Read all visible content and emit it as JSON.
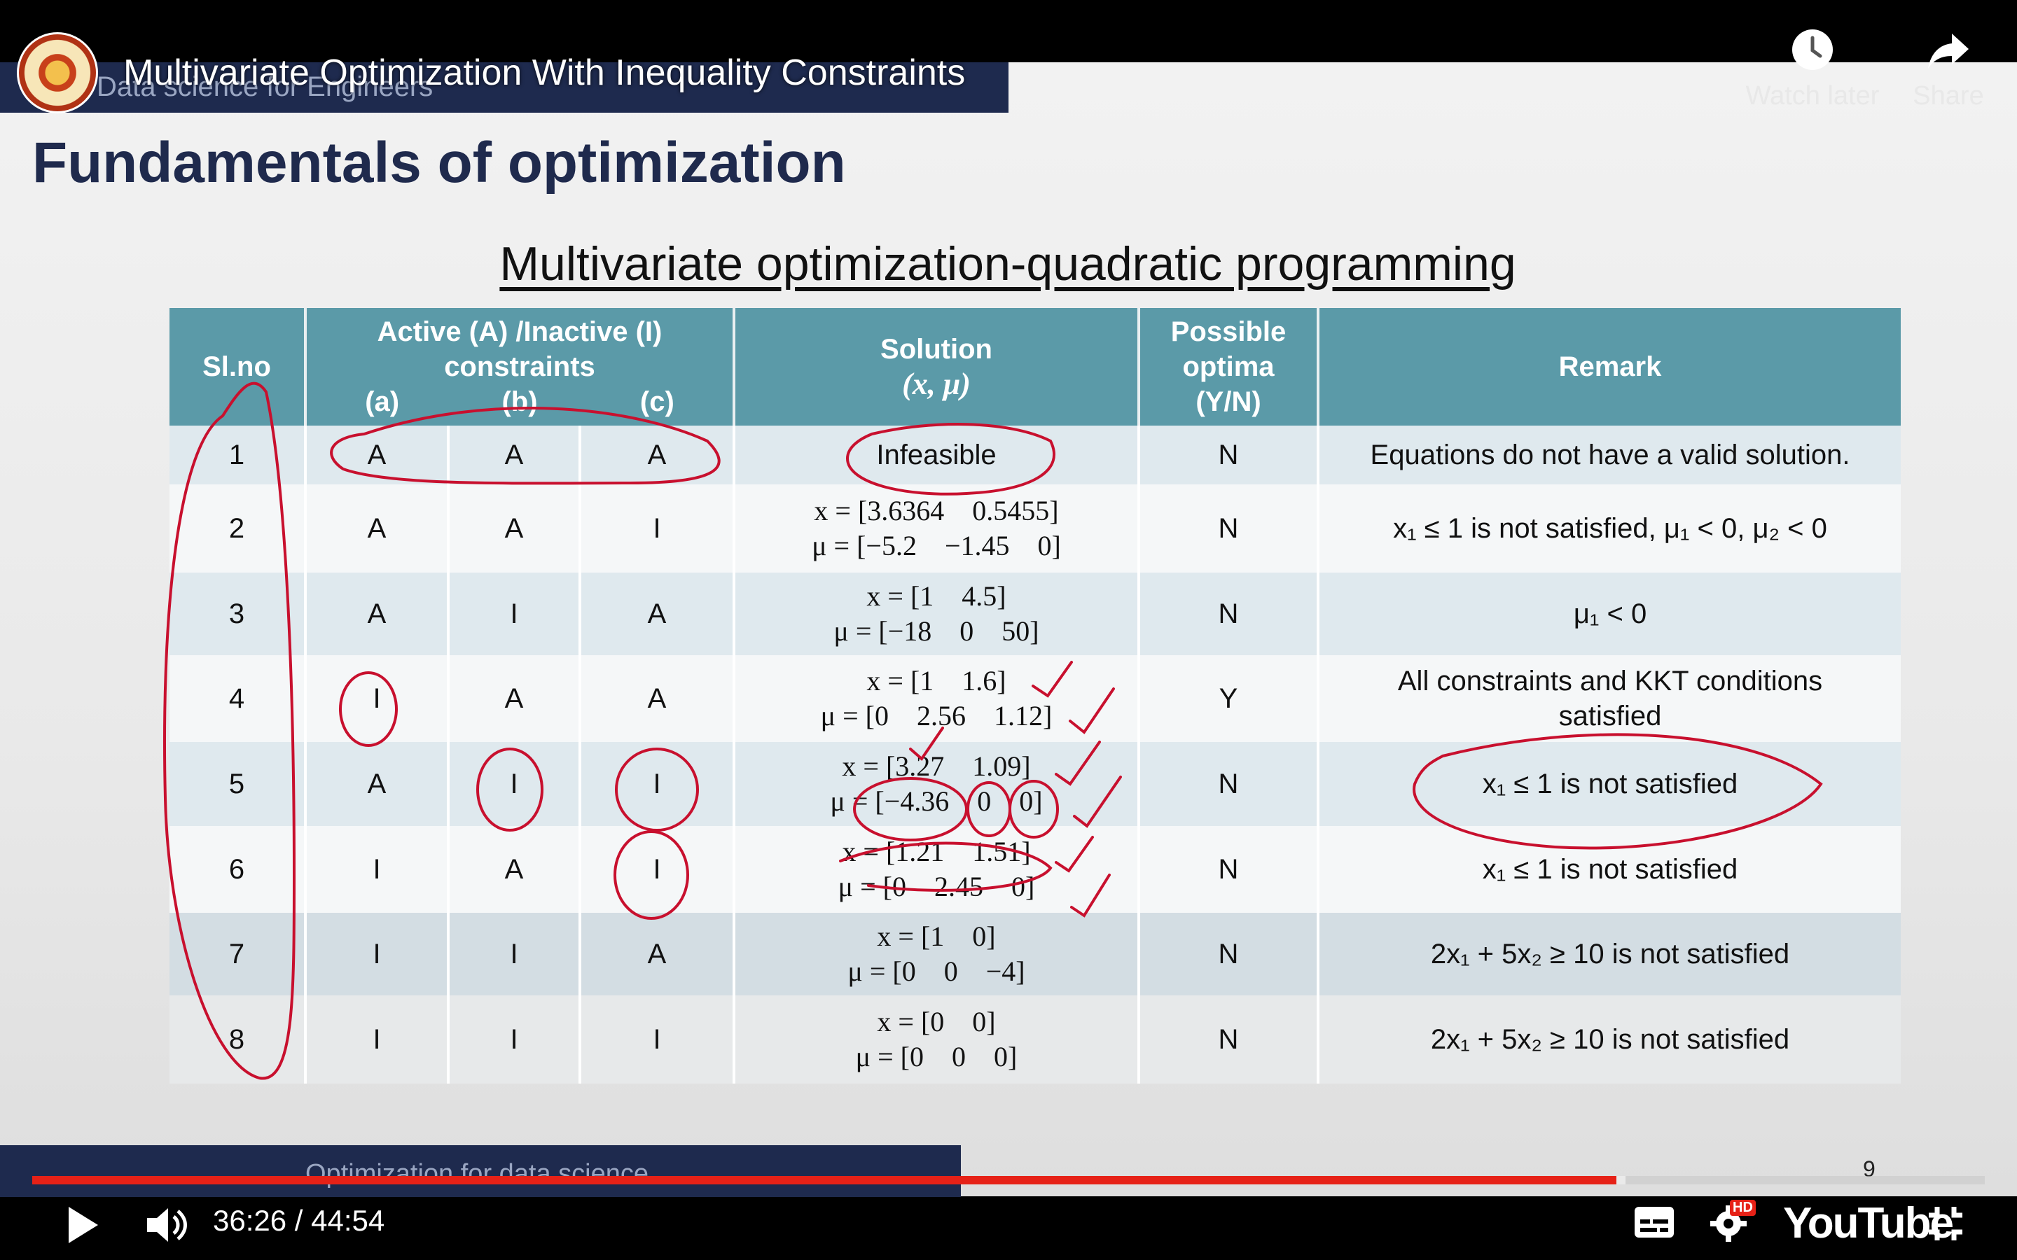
{
  "video": {
    "title": "Multivariate Optimization With Inequality Constraints",
    "time_current": "36:26",
    "time_total": "44:54",
    "time_separator": " / ",
    "progress_fraction": 0.8114,
    "buffer_fraction": 0.816
  },
  "top_actions": {
    "watch_later_label": "Watch later",
    "share_label": "Share"
  },
  "slide": {
    "course_name": "Data science for Engineers",
    "title": "Fundamentals of optimization",
    "table_heading": "Multivariate optimization-quadratic programming",
    "footer": "Optimization for data science",
    "page_number": "9"
  },
  "table": {
    "headers": {
      "slno": "Sl.no",
      "constraints": "Active (A) /Inactive (I) constraints",
      "sub_a": "(a)",
      "sub_b": "(b)",
      "sub_c": "(c)",
      "solution": "Solution",
      "solution_sub": "(x, μ)",
      "optima": "Possible optima (Y/N)",
      "remark": "Remark"
    },
    "rows": [
      {
        "no": "1",
        "a": "A",
        "b": "A",
        "c": "A",
        "sol1": "Infeasible",
        "sol2": "",
        "opt": "N",
        "remark": "Equations do not have a valid solution."
      },
      {
        "no": "2",
        "a": "A",
        "b": "A",
        "c": "I",
        "sol1": "x = [3.6364    0.5455]",
        "sol2": "μ = [−5.2    −1.45    0]",
        "opt": "N",
        "remark": "x₁ ≤ 1 is not satisfied, μ₁ < 0, μ₂ < 0"
      },
      {
        "no": "3",
        "a": "A",
        "b": "I",
        "c": "A",
        "sol1": "x = [1    4.5]",
        "sol2": "μ = [−18    0    50]",
        "opt": "N",
        "remark": "μ₁ < 0"
      },
      {
        "no": "4",
        "a": "I",
        "b": "A",
        "c": "A",
        "sol1": "x = [1    1.6]",
        "sol2": "μ = [0    2.56    1.12]",
        "opt": "Y",
        "remark": "All constraints and KKT conditions satisfied"
      },
      {
        "no": "5",
        "a": "A",
        "b": "I",
        "c": "I",
        "sol1": "x = [3.27    1.09]",
        "sol2": "μ = [−4.36    0    0]",
        "opt": "N",
        "remark": "x₁ ≤ 1 is not satisfied"
      },
      {
        "no": "6",
        "a": "I",
        "b": "A",
        "c": "I",
        "sol1": "x = [1.21    1.51]",
        "sol2": "μ = [0    2.45    0]",
        "opt": "N",
        "remark": "x₁ ≤ 1 is not satisfied"
      },
      {
        "no": "7",
        "a": "I",
        "b": "I",
        "c": "A",
        "sol1": "x = [1    0]",
        "sol2": "μ = [0    0    −4]",
        "opt": "N",
        "remark": "2x₁ + 5x₂ ≥ 10 is not satisfied"
      },
      {
        "no": "8",
        "a": "I",
        "b": "I",
        "c": "I",
        "sol1": "x = [0    0]",
        "sol2": "μ = [0    0    0]",
        "opt": "N",
        "remark": "2x₁ + 5x₂ ≥ 10 is not satisfied"
      }
    ]
  },
  "controls": {
    "youtube_label": "YouTube",
    "hd_badge": "HD"
  },
  "colors": {
    "header_teal": "#5b9aa8",
    "navy_bar": "#1e2a4e",
    "progress_red": "#e62117",
    "annotation_red": "#c8102e"
  }
}
